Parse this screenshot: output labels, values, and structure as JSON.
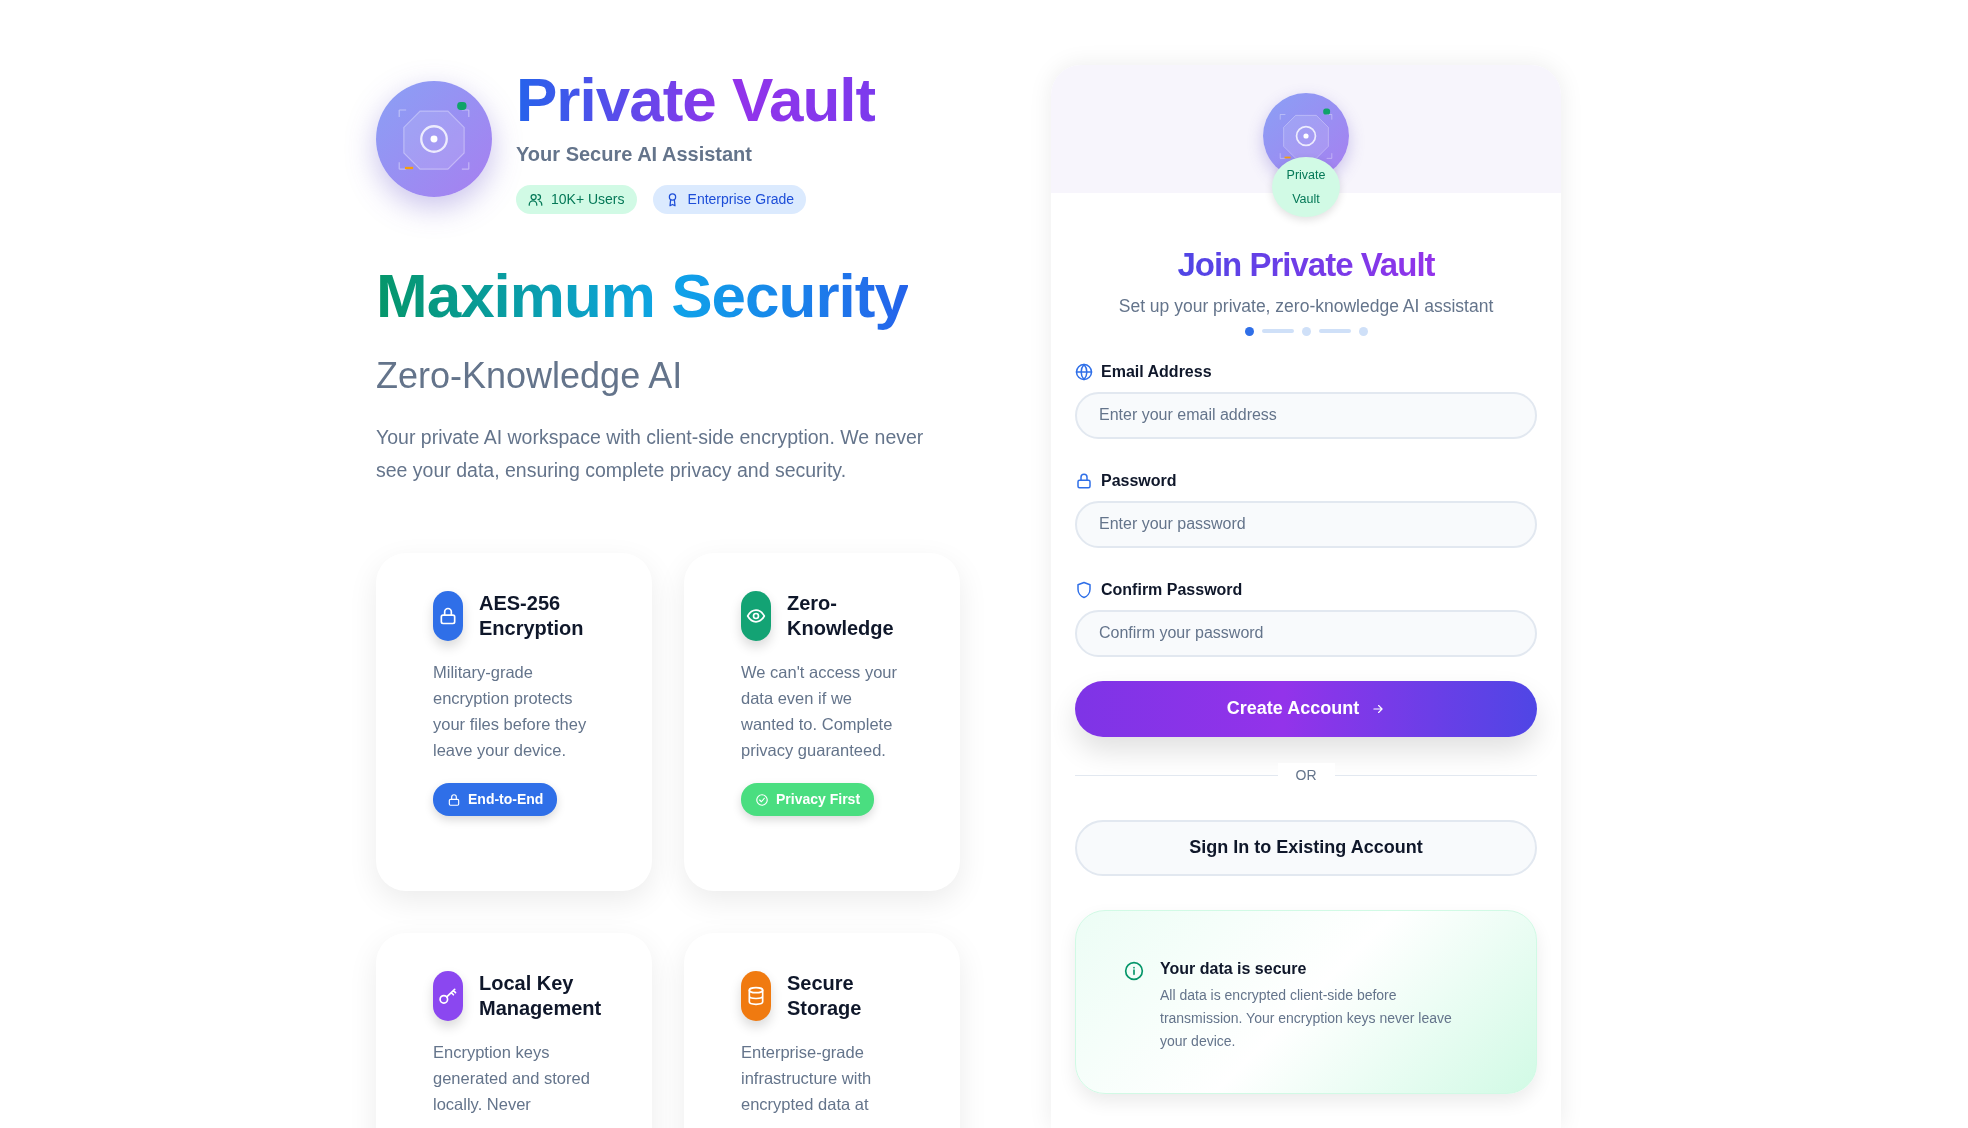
{
  "brand": {
    "title": "Private Vault",
    "tagline": "Your Secure AI Assistant",
    "badges": [
      {
        "label": "10K+ Users",
        "kind": "users"
      },
      {
        "label": "Enterprise Grade",
        "kind": "award"
      }
    ]
  },
  "hero": {
    "headline": "Maximum Security",
    "subheadline": "Zero-Knowledge AI",
    "description": "Your private AI workspace with client-side encryption. We never see your data, ensuring complete privacy and security."
  },
  "features": [
    {
      "title": "AES-256 Encryption",
      "kind": "lock",
      "color": "#2f6fe8",
      "text": "Military-grade encryption protects your files before they leave your device.",
      "tag": {
        "label": "End-to-End",
        "kind": "lock",
        "color": "#2f6fe8"
      }
    },
    {
      "title": "Zero-Knowledge",
      "kind": "eye",
      "color": "#13a374",
      "text": "We can't access your data even if we wanted to. Complete privacy guaranteed.",
      "tag": {
        "label": "Privacy First",
        "kind": "check",
        "color": "#4ade80"
      }
    },
    {
      "title": "Local Key Management",
      "kind": "key",
      "color": "#8b47f0",
      "text": "Encryption keys generated and stored locally. Never"
    },
    {
      "title": "Secure Storage",
      "kind": "database",
      "color": "#f07a10",
      "text": "Enterprise-grade infrastructure with encrypted data at"
    }
  ],
  "signup": {
    "badge": "Private Vault",
    "title": "Join Private Vault",
    "subtitle": "Set up your private, zero-knowledge AI assistant",
    "steps": [
      {
        "selected": true
      },
      {
        "selected": false
      },
      {
        "selected": false
      }
    ],
    "fields": [
      {
        "kind": "email",
        "label": "Email Address",
        "placeholder": "Enter your email address"
      },
      {
        "kind": "password",
        "label": "Password",
        "placeholder": "Enter your password"
      },
      {
        "kind": "confirm",
        "label": "Confirm Password",
        "placeholder": "Confirm your password"
      }
    ],
    "submit": "Create Account",
    "divider": "OR",
    "signin": "Sign In to Existing Account",
    "notice": {
      "title": "Your data is secure",
      "text": "All data is encrypted client-side before transmission. Your encryption keys never leave your device."
    }
  }
}
